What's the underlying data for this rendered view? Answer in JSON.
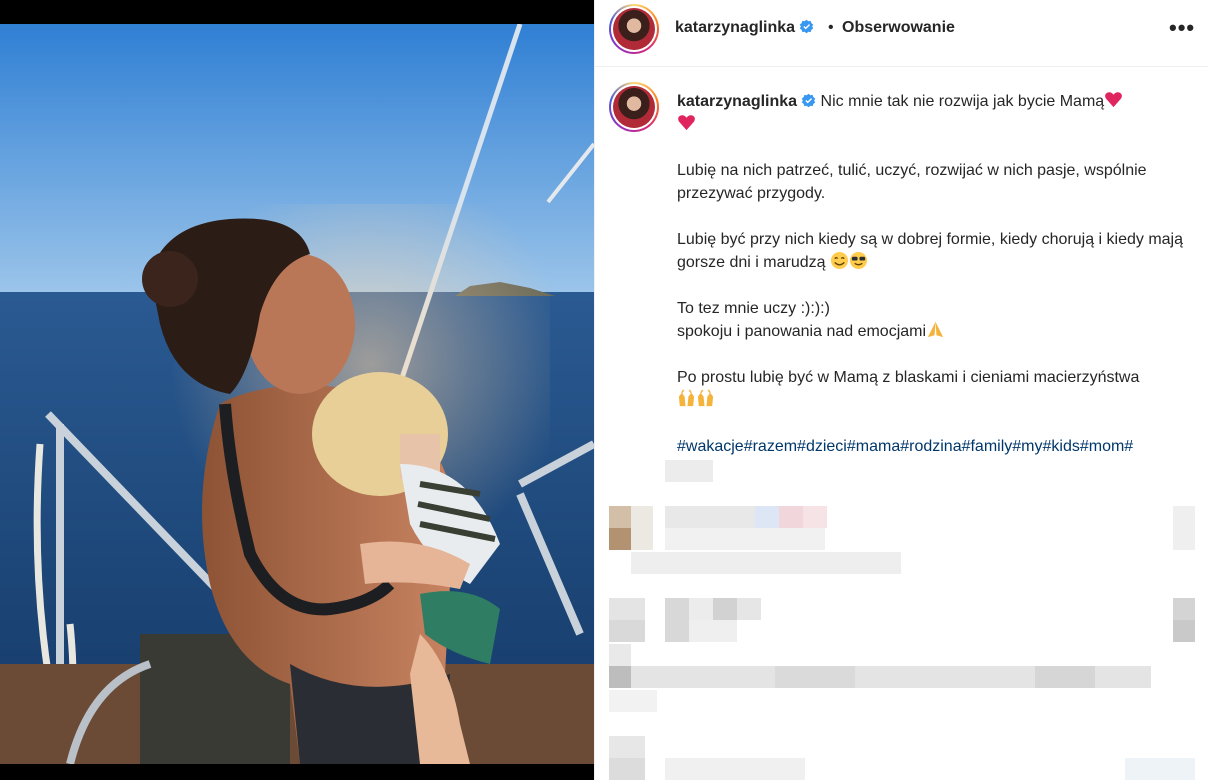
{
  "post": {
    "username": "katarzynaglinka",
    "separator": "•",
    "follow_label": "Obserwowanie",
    "more_label": "•••"
  },
  "caption": {
    "username": "katarzynaglinka",
    "line1": "Nic mnie tak nie rozwija jak bycie Mamą",
    "para1": "Lubię na nich patrzeć, tulić, uczyć, rozwijać w nich pasje, wspólnie przezywać przygody.",
    "para2": "Lubię być przy nich kiedy są w dobrej formie, kiedy chorują i kiedy mają gorsze dni i marudzą",
    "para3_line1": "To tez mnie uczy :):):)",
    "para3_line2": "spokoju i panowania nad emocjami",
    "para4": "Po prostu lubię być w Mamą z blaskami i cieniami macierzyństwa",
    "hashtags": "#wakacje#razem#dzieci#mama#rodzina#family#my#kids#mom#"
  },
  "icons": {
    "verified": "verified-badge-icon",
    "heart": "red-heart-emoji",
    "grin": "smiling-face-emoji",
    "sunglasses": "sunglasses-face-emoji",
    "pray": "folded-hands-emoji",
    "raised_hands": "raised-hands-emoji",
    "more": "more-options-icon"
  },
  "colors": {
    "verified": "#3897f0",
    "hashtag": "#00376b",
    "heart": "#e0245e",
    "sea": "#1e4f86",
    "sky": "#3f8fd8"
  }
}
